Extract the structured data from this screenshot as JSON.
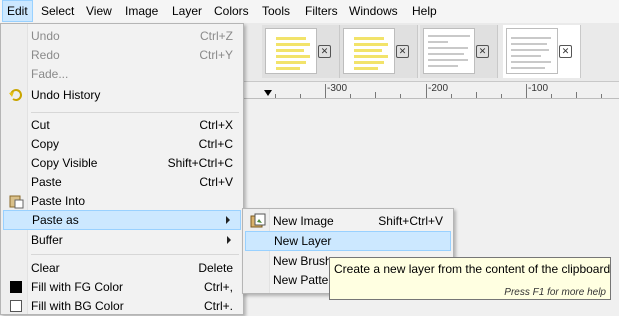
{
  "menubar": {
    "items": [
      {
        "label": "Edit"
      },
      {
        "label": "Select"
      },
      {
        "label": "View"
      },
      {
        "label": "Image"
      },
      {
        "label": "Layer"
      },
      {
        "label": "Colors"
      },
      {
        "label": "Tools"
      },
      {
        "label": "Filters"
      },
      {
        "label": "Windows"
      },
      {
        "label": "Help"
      }
    ]
  },
  "ruler": {
    "labels": [
      "-300",
      "-200",
      "-100"
    ]
  },
  "edit_menu": {
    "items": [
      {
        "label": "Undo",
        "shortcut": "Ctrl+Z",
        "enabled": false,
        "icon": "undo-icon"
      },
      {
        "label": "Redo",
        "shortcut": "Ctrl+Y",
        "enabled": false,
        "icon": "redo-icon"
      },
      {
        "label": "Fade...",
        "shortcut": "",
        "enabled": false,
        "icon": ""
      },
      {
        "label": "Undo History",
        "shortcut": "",
        "enabled": true,
        "icon": "undo-history-icon"
      },
      {
        "label": "Cut",
        "shortcut": "Ctrl+X",
        "enabled": true,
        "icon": "cut-icon"
      },
      {
        "label": "Copy",
        "shortcut": "Ctrl+C",
        "enabled": true,
        "icon": "copy-icon"
      },
      {
        "label": "Copy Visible",
        "shortcut": "Shift+Ctrl+C",
        "enabled": true,
        "icon": ""
      },
      {
        "label": "Paste",
        "shortcut": "Ctrl+V",
        "enabled": true,
        "icon": "paste-icon"
      },
      {
        "label": "Paste Into",
        "shortcut": "",
        "enabled": true,
        "icon": "paste-into-icon"
      },
      {
        "label": "Paste as",
        "shortcut": "",
        "enabled": true,
        "icon": "",
        "submenu": true
      },
      {
        "label": "Buffer",
        "shortcut": "",
        "enabled": true,
        "icon": "",
        "submenu": true
      },
      {
        "label": "Clear",
        "shortcut": "Delete",
        "enabled": true,
        "icon": "clear-icon"
      },
      {
        "label": "Fill with FG Color",
        "shortcut": "Ctrl+,",
        "enabled": true,
        "icon": "fg-color-swatch-icon"
      },
      {
        "label": "Fill with BG Color",
        "shortcut": "Ctrl+.",
        "enabled": true,
        "icon": "bg-color-swatch-icon"
      }
    ]
  },
  "paste_as_menu": {
    "items": [
      {
        "label": "New Image",
        "shortcut": "Shift+Ctrl+V",
        "icon": "new-image-icon"
      },
      {
        "label": "New Layer",
        "shortcut": "",
        "icon": ""
      },
      {
        "label": "New Brush...",
        "shortcut": "",
        "icon": ""
      },
      {
        "label": "New Pattern...",
        "shortcut": "",
        "icon": ""
      }
    ]
  },
  "tooltip": {
    "text": "Create a new layer from the content of the clipboard",
    "help": "Press F1 for more help"
  },
  "colors": {
    "highlight": "#cce8ff",
    "highlight_border": "#99d1ff",
    "tooltip_bg": "#ffffe1"
  }
}
